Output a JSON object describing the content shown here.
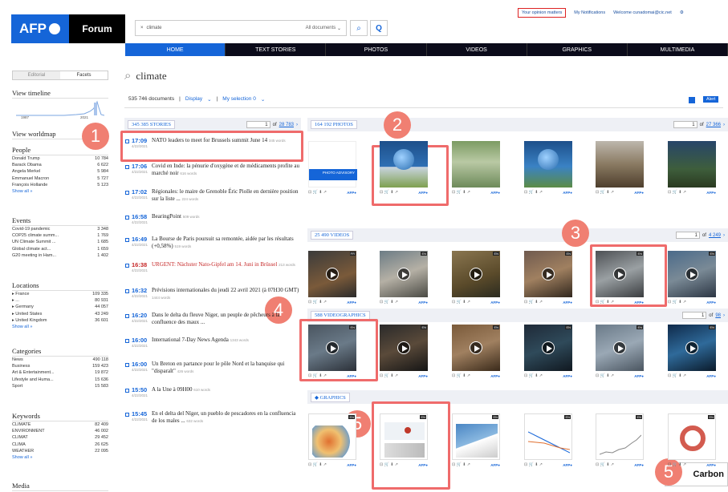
{
  "header": {
    "logo": "AFP",
    "forum": "Forum",
    "search_value": "climate",
    "all_documents": "All documents",
    "opinion": "Your opinion matters",
    "notifications": "My Notifications",
    "welcome": "Welcome cunadomai@cic.net"
  },
  "nav": [
    "HOME",
    "TEXT STORIES",
    "PHOTOS",
    "VIDEOS",
    "GRAPHICS",
    "MULTIMEDIA"
  ],
  "sidebar": {
    "tabs": [
      "Editorial",
      "Facets"
    ],
    "timeline_title": "View timeline",
    "timeline_start": "1987",
    "timeline_end": "2021",
    "worldmap_title": "View worldmap",
    "sections": [
      {
        "title": "People",
        "rows": [
          [
            "Donald Trump",
            "10 784"
          ],
          [
            "Barack Obama",
            "6 622"
          ],
          [
            "Angela Merkel",
            "5 984"
          ],
          [
            "Emmanuel Macron",
            "5 727"
          ],
          [
            "François Hollande",
            "5 123"
          ]
        ]
      },
      {
        "title": "Events",
        "rows": [
          [
            "Covid-19 pandemic",
            "3 348"
          ],
          [
            "COP25 climate summ...",
            "1 769"
          ],
          [
            "UN Climate Summit ...",
            "1 685"
          ],
          [
            "Global climate act...",
            "1 659"
          ],
          [
            "G20 meeting in Ham...",
            "1 402"
          ]
        ]
      },
      {
        "title": "Locations",
        "rows": [
          [
            "France",
            "109 335"
          ],
          [
            "...",
            "80 931"
          ],
          [
            "Germany",
            "44 057"
          ],
          [
            "United States",
            "43 249"
          ],
          [
            "United Kingdom",
            "36 601"
          ]
        ]
      },
      {
        "title": "Categories",
        "rows": [
          [
            "News",
            "490 118"
          ],
          [
            "Business",
            "159 423"
          ],
          [
            "Art & Entertainment...",
            "19 872"
          ],
          [
            "Lifestyle and Huma...",
            "15 636"
          ],
          [
            "Sport",
            "15 583"
          ]
        ]
      },
      {
        "title": "Keywords",
        "rows": [
          [
            "CLIMATE",
            "82 409"
          ],
          [
            "ENVIRONMENT",
            "46 002"
          ],
          [
            "CLIMAT",
            "29 452"
          ],
          [
            "CLIMA",
            "26 625"
          ],
          [
            "WEATHER",
            "22 095"
          ]
        ]
      },
      {
        "title": "Media",
        "rows": []
      }
    ],
    "show_all": "Show all »"
  },
  "results": {
    "query": "climate",
    "count": "535 746 documents",
    "display": "Display",
    "selection": "My selection 0",
    "alert": "Alert"
  },
  "stories": {
    "label": "345 385 STORIES",
    "page": "1",
    "of": "of",
    "total": "28 783",
    "items": [
      {
        "time": "17:09",
        "date": "4/22/2021",
        "title": "NATO leaders to meet for Brussels summit June 14",
        "words": "345 words",
        "red": false
      },
      {
        "time": "17:06",
        "date": "4/22/2021",
        "title": "Covid en Inde: la pénurie d'oxygène et de médicaments profite au marché noir",
        "words": "616 words",
        "red": false
      },
      {
        "time": "17:02",
        "date": "4/22/2021",
        "title": "Régionales: le maire de Grenoble Éric Piolle en dernière position sur la liste ...",
        "words": "224 words",
        "red": false
      },
      {
        "time": "16:58",
        "date": "4/22/2021",
        "title": "BearingPoint",
        "words": "509 words",
        "red": false
      },
      {
        "time": "16:49",
        "date": "4/22/2021",
        "title": "La Bourse de Paris poursuit sa remontée, aidée par les résultats (+0,58%)",
        "words": "519 words",
        "red": false
      },
      {
        "time": "16:38",
        "date": "4/22/2021",
        "title": "URGENT: Nächster Nato-Gipfel am 14. Juni in Brüssel",
        "words": "213 words",
        "red": true
      },
      {
        "time": "16:32",
        "date": "4/22/2021",
        "title": "Prévisions internationales du jeudi 22 avril 2021 (à 07H30 GMT)",
        "words": "1444 words",
        "red": false
      },
      {
        "time": "16:20",
        "date": "4/22/2021",
        "title": "Dans le delta du fleuve Niger, un peuple de pêcheurs à la confluence des maux ...",
        "words": "",
        "red": false
      },
      {
        "time": "16:00",
        "date": "4/22/2021",
        "title": "International 7-Day News Agenda",
        "words": "1343 words",
        "red": false
      },
      {
        "time": "16:00",
        "date": "4/22/2021",
        "title": "Un Breton en partance pour le pôle Nord et la banquise qui \"disparaît\"",
        "words": "426 words",
        "red": false
      },
      {
        "time": "15:50",
        "date": "4/22/2021",
        "title": "A la Une à 09H00",
        "words": "610 words",
        "red": false
      },
      {
        "time": "15:45",
        "date": "4/22/2021",
        "title": "En el delta del Níger, un pueblo de pescadores en la confluencia de los males ...",
        "words": "632 words",
        "red": false
      }
    ]
  },
  "photos": {
    "label": "164 192 PHOTOS",
    "page": "1",
    "of": "of",
    "total": "27 366",
    "advisory": "PHOTO ADVISORY"
  },
  "videos": {
    "label": "25 490 VIDEOS",
    "page": "1",
    "of": "of",
    "total": "4 249"
  },
  "videographics": {
    "label": "588 VIDEOGRAPHICS",
    "page": "1",
    "of": "of",
    "total": "98"
  },
  "graphics": {
    "label": "GRAPHICS"
  },
  "tags": {
    "fr": "FR",
    "en": "EN"
  },
  "thumbbar": {
    "icons": "⊡ 🛒 ⬇ ↗",
    "afp": "AFP●"
  },
  "annotations": [
    "1",
    "2",
    "3",
    "4",
    "5",
    "5"
  ],
  "carbon": "Carbon",
  "colors": {
    "accent": "#1565d8",
    "highlight": "#ef6b6b",
    "annot": "#f07f72"
  }
}
